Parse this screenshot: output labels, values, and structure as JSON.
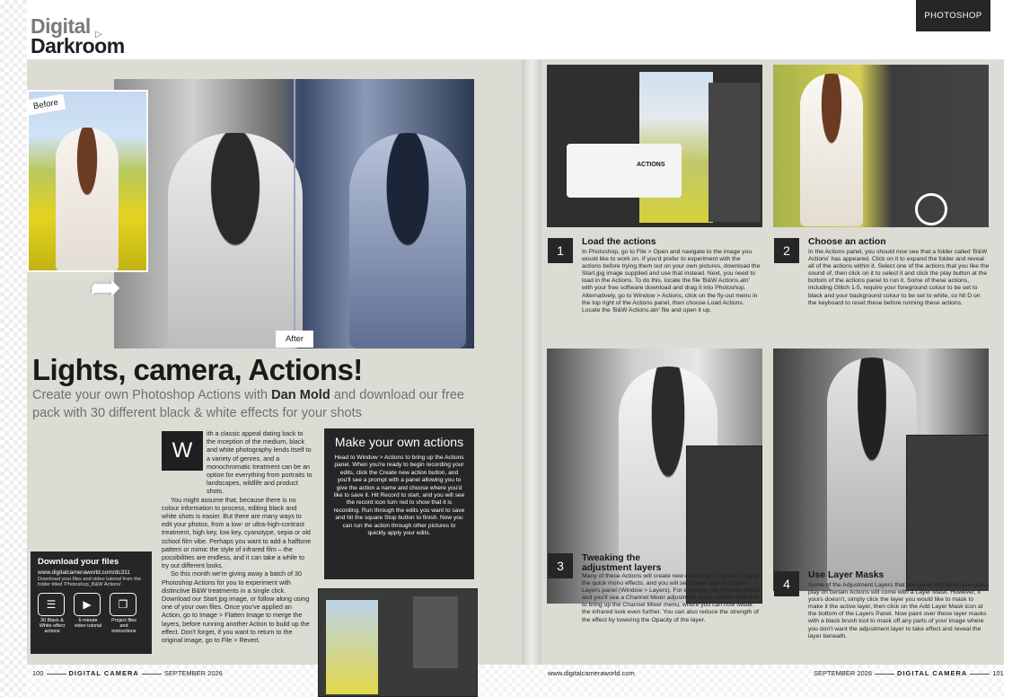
{
  "header": {
    "logo_line1": "Digital",
    "logo_line2": "Darkroom",
    "section": "PHOTOSHOP"
  },
  "hero": {
    "before_label": "Before",
    "after_label": "After"
  },
  "article": {
    "headline": "Lights, camera, Actions!",
    "standfirst_pre": "Create your own Photoshop Actions with ",
    "standfirst_author": "Dan Mold",
    "standfirst_post": " and download our free pack with 30 different black & white effects for your shots",
    "dropcap": "W",
    "body_p1": "ith a classic appeal dating back to the inception of the medium, black and white photography lends itself to a variety of genres, and a monochromatic treatment can be an option for everything from portraits to landscapes, wildlife and product shots.",
    "body_p2": "You might assume that, because there is no colour information to process, editing black and white shots is easier. But there are many ways to edit your photos, from a low- or ultra-high-contrast treatment, high key, low key, cyanotype, sepia or old school film vibe. Perhaps you want to add a halftone pattern or mimic the style of infrared film – the possibilities are endless, and it can take a while to try out different looks.",
    "body_p3": "So this month we're giving away a batch of 30 Photoshop Actions for you to experiment with distinctive B&W treatments in a single click. Download our Start.jpg image, or follow along using one of your own files. Once you've applied an Action, go to Image > Flatten Image to merge the layers, before running another Action to build up the effect. Don't forget, if you want to return to the original image, go to File > Revert."
  },
  "download": {
    "title": "Download your files",
    "url": "www.digitalcameraworld.com/dc311",
    "sub": "Download your files and video tutorial from the folder titled 'Photoshop_B&W Actions'.",
    "items": [
      {
        "icon": "sliders-icon",
        "label": "30 Black & White effect actions"
      },
      {
        "icon": "video-icon",
        "label": "6-minute video tutorial"
      },
      {
        "icon": "files-icon",
        "label": "Project files and instructions"
      }
    ]
  },
  "makebox": {
    "title": "Make your own actions",
    "body": "Head to Window > Actions to bring up the Actions panel. When you're ready to begin recording your edits, click the Create new action button, and you'll see a prompt with a panel allowing you to give the action a name and choose where you'd like to save it. Hit Record to start, and you will see the record icon turn red to show that it is recording. Run through the edits you want to save and hit the square Stop button to finish. Now you can run the action through other pictures to quickly apply your edits."
  },
  "screens": {
    "actions_label": "ACTIONS"
  },
  "steps": [
    {
      "num": "1",
      "title": "Load the actions",
      "body": "In Photoshop, go to File > Open and navigate to the image you would like to work on. If you'd prefer to experiment with the actions before trying them out on your own pictures, download the Start.jpg image supplied and use that instead. Next, you need to load in the Actions. To do this, locate the file 'B&W Actions.atn' with your free software download and drag it into Photoshop. Alternatively, go to Window > Actions, click on the fly-out menu in the top right of the Actions panel, then choose Load Actions. Locate the 'B&W Actions.atn' file and open it up."
    },
    {
      "num": "2",
      "title": "Choose an action",
      "body": "In the Actions panel, you should now see that a folder called 'B&W Actions' has appeared. Click on it to expand the folder and reveal all of the actions within it. Select one of the actions that you like the sound of, then click on it to select it and click the play button at the bottom of the actions panel to run it. Some of these actions, including Glitch 1-5, require your foreground colour to be set to black and your background colour to be set to white, so hit D on the keyboard to reset these before running these actions."
    },
    {
      "num": "3",
      "title": "Tweaking the adjustment layers",
      "body": "Many of these Actions will create new Adjustment Layers to apply the quick mono effects, and you will see these appear in your Layers panel (Window > Layers). For example, run Infrared Action and you'll see a Channel Mixer adjustment layer; double-click this to bring up the Channel Mixer menu, where you can now tweak the infrared look even further. You can also reduce the strength of the effect by lowering the Opacity of the layer."
    },
    {
      "num": "4",
      "title": "Use Layer Masks",
      "body": "Some of the Adjustment Layers that are generated when you press play on certain Actions will come with a Layer Mask. However, if yours doesn't, simply click the layer you would like to mask to make it the active layer, then click on the Add Layer Mask icon at the bottom of the Layers Panel. Now paint over these layer masks with a black brush tool to mask off any parts of your image where you don't want the adjustment layer to take effect and reveal the layer beneath."
    }
  ],
  "footer": {
    "left_page": "100",
    "left_mag": "DIGITAL CAMERA",
    "left_date": "SEPTEMBER 2026",
    "center_url": "www.digitalcameraworld.com",
    "right_date": "SEPTEMBER 2026",
    "right_mag": "DIGITAL CAMERA",
    "right_page": "101"
  }
}
